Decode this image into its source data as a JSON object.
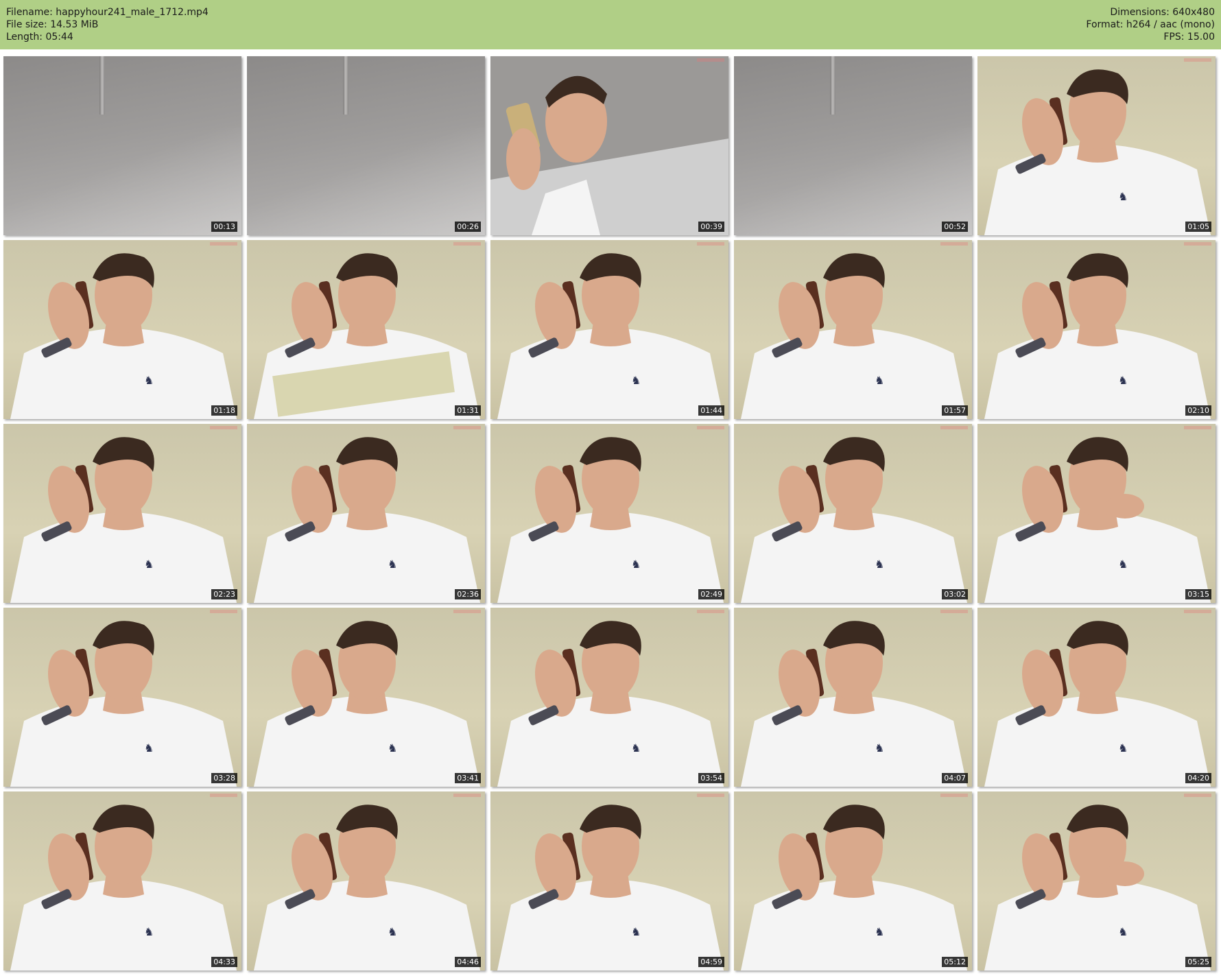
{
  "header": {
    "filename": "Filename: happyhour241_male_1712.mp4",
    "file_size": "File size: 14.53 MiB",
    "length": "Length: 05:44",
    "dimensions": "Dimensions: 640x480",
    "format": "Format: h264 / aac (mono)",
    "fps": "FPS: 15.00",
    "background_color": "#b0cf86"
  },
  "thumbnails": [
    {
      "time": "00:13",
      "scene": "ceiling"
    },
    {
      "time": "00:26",
      "scene": "ceiling"
    },
    {
      "time": "00:39",
      "scene": "person-phone-close"
    },
    {
      "time": "00:52",
      "scene": "ceiling"
    },
    {
      "time": "01:05",
      "scene": "person-phone"
    },
    {
      "time": "01:18",
      "scene": "person-phone"
    },
    {
      "time": "01:31",
      "scene": "person-phone-food"
    },
    {
      "time": "01:44",
      "scene": "person-phone"
    },
    {
      "time": "01:57",
      "scene": "person-phone"
    },
    {
      "time": "02:10",
      "scene": "person-phone"
    },
    {
      "time": "02:23",
      "scene": "person-phone"
    },
    {
      "time": "02:36",
      "scene": "person-phone"
    },
    {
      "time": "02:49",
      "scene": "person-phone"
    },
    {
      "time": "03:02",
      "scene": "person-phone"
    },
    {
      "time": "03:15",
      "scene": "person-phone-eating"
    },
    {
      "time": "03:28",
      "scene": "person-phone"
    },
    {
      "time": "03:41",
      "scene": "person-phone"
    },
    {
      "time": "03:54",
      "scene": "person-phone"
    },
    {
      "time": "04:07",
      "scene": "person-phone"
    },
    {
      "time": "04:20",
      "scene": "person-phone"
    },
    {
      "time": "04:33",
      "scene": "person-phone"
    },
    {
      "time": "04:46",
      "scene": "person-phone"
    },
    {
      "time": "04:59",
      "scene": "person-phone"
    },
    {
      "time": "05:12",
      "scene": "person-phone"
    },
    {
      "time": "05:25",
      "scene": "person-phone-eating"
    }
  ]
}
